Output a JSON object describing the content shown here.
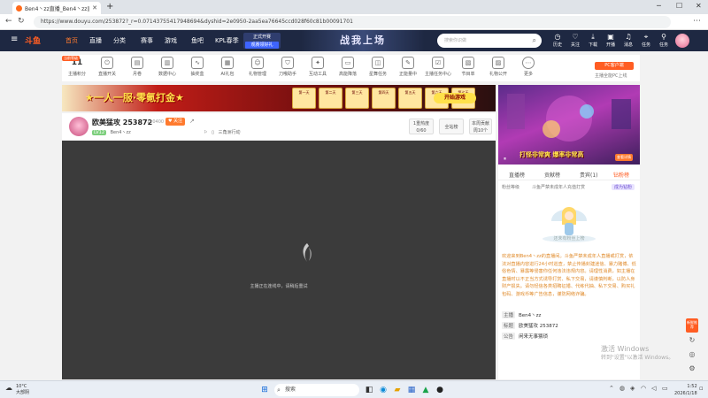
{
  "browser": {
    "tab_title": "Ben4丶zz直播_Ben4丶zz直播_Ben4",
    "url": "https://www.douyu.com/253872?_r=0.07143755417948694&dyshid=2e0950-2aa5ea76645ccd028f60c81b00091701"
  },
  "header": {
    "logo": "斗鱼",
    "nav": [
      "首页",
      "直播",
      "分类",
      "赛事",
      "游戏",
      "鱼吧",
      "KPL春季"
    ],
    "kpl_badge_line1": "正式开赛",
    "kpl_badge_line2": "观赛领好礼",
    "banner_text": "战我上场",
    "search_placeholder": "搜索你识做",
    "icons": [
      "历史",
      "关注",
      "下载",
      "开播",
      "消息",
      "任务",
      "任务"
    ]
  },
  "toolbar": {
    "level": "11",
    "level_tag": "当前等级",
    "level_label": "主播积分",
    "items": [
      "直播开关",
      "月卷",
      "数据中心",
      "抽奖盒",
      "AI礼包",
      "礼物管理",
      "刀哦助手",
      "互动工具",
      "高能降落",
      "星舞任务",
      "正能量中",
      "主播任务中心",
      "节目单",
      "礼物公开",
      "更多"
    ]
  },
  "pc_button": "PC客户端",
  "pc_sub": "主播全能PC上线",
  "ad": {
    "title": "★一人一服·零氪打金★",
    "gifts": [
      "第一天",
      "第二天",
      "第三天",
      "第四天",
      "第五天",
      "第六天",
      "第七天"
    ],
    "start_button": "开始游戏"
  },
  "streamer": {
    "title": "欧美猛攻 253872",
    "count": "110400",
    "follow_label": "关注",
    "level": "LV12",
    "name": "Ben4丶zz",
    "category": "三角洲行动",
    "stat_box_1_top": "1重热度",
    "stat_box_1_bottom": "0/60",
    "stat_box_2": "全站榜",
    "stat_box_3_top": "本周贡献",
    "stat_box_3_bottom": "周10个"
  },
  "video": {
    "message": "主播正在连线中，请稍后重试"
  },
  "right_panel": {
    "ad_text": "打怪非常爽 爆率非常高",
    "ad_button": "查看详情",
    "tabs": [
      "直播榜",
      "贡献榜",
      "贵宾(1)",
      "钻粉榜"
    ],
    "sub_left": "粉丝等级",
    "sub_mid": "斗鱼严禁未成年人充值打赏",
    "sub_btn": "成为钻粉",
    "mascot_text": "还未有粉丝上榜",
    "notice": "欢迎来到Ben4丶zz的直播间。斗鱼严禁未成年人直播或打赏，依法对直播内容进行24小时巡查，禁止传播封建迷信、暴力赌博、低俗色情、暴露等侵害你任何违法违规内容。请理性消费，如主播在直播时以不正当方式诱导打赏、私下交易，请谨慎判断，以防人身财产损失。请勿轻信各类招聘征婚、代练代抽、私下交易、购买礼包码、游戏币等广告信息，谨防网络诈骗。",
    "info": [
      {
        "label": "主播",
        "value": "Ben4丶zz"
      },
      {
        "label": "标题",
        "value": "欧美猛攻 253872"
      },
      {
        "label": "公告",
        "value": "闲来无事猥琐"
      }
    ]
  },
  "side_float_label": "新鲜推荐",
  "activate": {
    "line1": "激活 Windows",
    "line2": "转到\"设置\"以激活 Windows。"
  },
  "taskbar": {
    "temp": "10°C",
    "weather": "大部阴",
    "search": "搜索",
    "time": "1:52",
    "date": "2026/1/18"
  }
}
